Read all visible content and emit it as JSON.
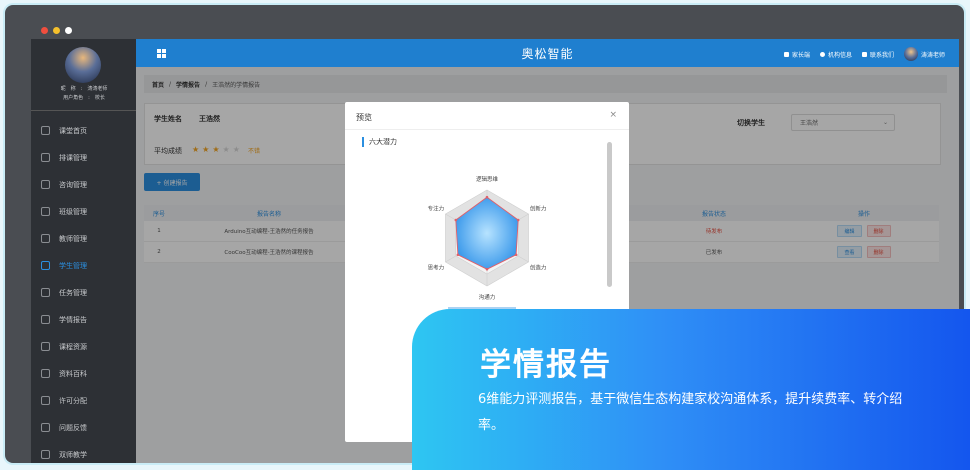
{
  "window": {
    "dots": [
      "#f04e3e",
      "#f5c02c",
      "#ffffff"
    ]
  },
  "sidebar": {
    "user_row1": [
      "昵",
      "称",
      ":",
      "涛涛老师"
    ],
    "user_row2": [
      "用户角色",
      ":",
      "校长"
    ],
    "items": [
      {
        "label": "课堂首页",
        "icon": "home-icon"
      },
      {
        "label": "排课管理",
        "icon": "calendar-icon"
      },
      {
        "label": "咨询管理",
        "icon": "headset-icon"
      },
      {
        "label": "班级管理",
        "icon": "folder-icon"
      },
      {
        "label": "教师管理",
        "icon": "teacher-icon"
      },
      {
        "label": "学生管理",
        "icon": "student-icon",
        "active": true
      },
      {
        "label": "任务管理",
        "icon": "clipboard-icon"
      },
      {
        "label": "学情报告",
        "icon": "report-icon"
      },
      {
        "label": "课程资源",
        "icon": "book-icon"
      },
      {
        "label": "资料百科",
        "icon": "archive-icon"
      },
      {
        "label": "许可分配",
        "icon": "link-icon"
      },
      {
        "label": "问题反馈",
        "icon": "feedback-icon"
      },
      {
        "label": "双师教学",
        "icon": "chat-icon"
      }
    ]
  },
  "header": {
    "brand": "奥松智能",
    "links": [
      "家长端",
      "机构信息",
      "联系我们"
    ],
    "user": "涛涛老师"
  },
  "breadcrumb": [
    "首页",
    "/",
    "学情报告",
    "/",
    "王浩然的学情报告"
  ],
  "student": {
    "name_label": "学生姓名",
    "name": "王浩然",
    "score_label": "平均成绩",
    "stars_filled": 3,
    "stars_total": 5,
    "grade": "不错",
    "switch_label": "切换学生",
    "switch_value": "王浩然"
  },
  "create_button": "+ 创建报告",
  "table": {
    "headers": [
      "序号",
      "报告名称",
      "报告状态",
      "操作"
    ],
    "rows": [
      {
        "index": "1",
        "name": "Arduino互动编程-王浩然的任务报告",
        "status": "待发布",
        "pending": true,
        "actions": [
          "编辑",
          "删除"
        ]
      },
      {
        "index": "2",
        "name": "CooCoo互动编程-王浩然的课程报告",
        "status": "已发布",
        "pending": false,
        "actions": [
          "查看",
          "删除"
        ]
      }
    ]
  },
  "modal": {
    "title": "预览",
    "close": "×",
    "section": "六大潜力",
    "radar": {
      "axes": [
        "逻辑思维",
        "创新力",
        "创造力",
        "沟通力",
        "思考力",
        "专注力"
      ],
      "values": [
        0.85,
        0.75,
        0.7,
        0.65,
        0.7,
        0.75
      ],
      "levels": 4
    }
  },
  "promo": {
    "title": "学情报告",
    "text": "6维能力评测报告，基于微信生态构建家校沟通体系，提升续费率、转介绍率。"
  },
  "colors": {
    "accent": "#2b8fe0",
    "header": "#1f7fcf",
    "sidebar": "#2d3035",
    "star": "#f5a623",
    "danger": "#e84c3d"
  }
}
